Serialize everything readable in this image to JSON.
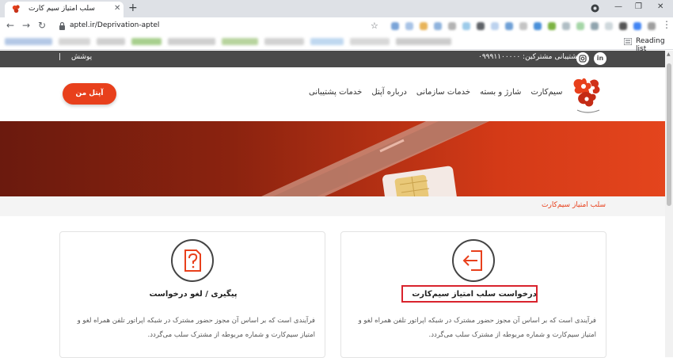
{
  "browser": {
    "tab_title": "سلب امتیاز سیم کارت",
    "url": "aptel.ir/Deprivation-aptel",
    "reading_list": "Reading list",
    "new_tab_symbol": "+",
    "close_symbol": "✕",
    "minimize_symbol": "—",
    "maximize_symbol": "❐",
    "back_symbol": "←",
    "forward_symbol": "→",
    "reload_symbol": "↻",
    "star_symbol": "☆"
  },
  "topbar": {
    "support_text": "پشتیبانی مشترکین: ۰۹۹۹۱۱۰۰۰۰۰",
    "login_label": "پوشش",
    "separator": "|",
    "linkedin_label": "in"
  },
  "header": {
    "nav": [
      "سیم‌کارت",
      "شارژ و بسته",
      "خدمات سازمانی",
      "درباره آپتل",
      "خدمات پشتیبانی"
    ],
    "cta_label": "آپتل من"
  },
  "breadcrumb": "سلب امتیاز سیم‌کارت",
  "cards": [
    {
      "title": "درخواست سلب امتیاز سیم‌کارت",
      "desc": "فرآیندی است که بر اساس آن مجوز حضور مشترک در شبکه اپراتور تلفن همراه لغو و امتیاز سیم‌کارت و شماره مربوطه از مشترک سلب می‌گردد.",
      "icon": "exit-arrow-icon"
    },
    {
      "title": "پیگیری / لغو درخواست",
      "desc": "فرآیندی است که بر اساس آن مجوز حضور مشترک در شبکه اپراتور تلفن همراه لغو و امتیاز سیم‌کارت و شماره مربوطه از مشترک سلب می‌گردد.",
      "icon": "question-document-icon"
    }
  ],
  "colors": {
    "accent": "#e8401c",
    "topbar": "#4a4a4a",
    "highlight": "#d9232d"
  }
}
